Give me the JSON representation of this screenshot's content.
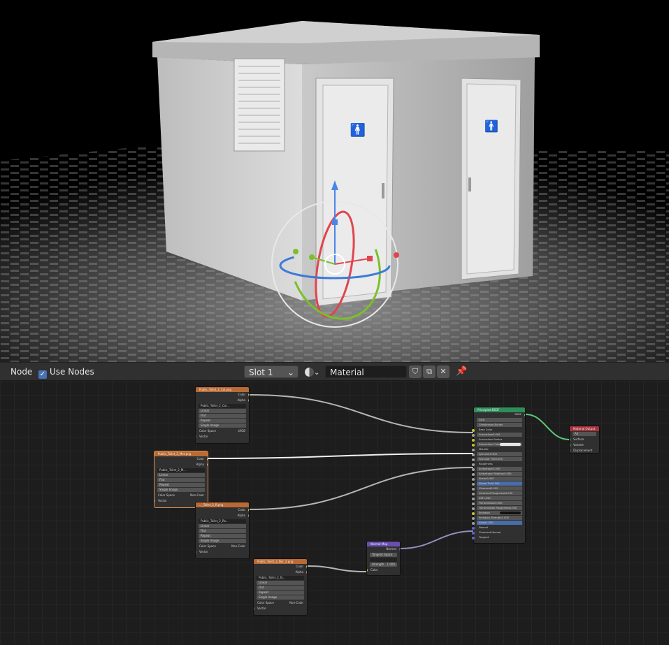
{
  "header": {
    "editor_type": "Node",
    "use_nodes_label": "Use Nodes",
    "slot": "Slot 1",
    "material_name": "Material"
  },
  "nodes": {
    "tex1": {
      "title": "Public_Toilet_2_Col.png",
      "out1": "Color",
      "out2": "Alpha",
      "image": "Public_Toilet_2_Col...",
      "interp": "Linear",
      "proj": "Flat",
      "ext": "Repeat",
      "source": "Single Image",
      "cs_label": "Color Space",
      "cs_value": "sRGB",
      "vector": "Vector"
    },
    "tex2": {
      "title": "Public_Toilet_2_Met.png",
      "out1": "Color",
      "out2": "Alpha",
      "image": "Public_Toilet_2_M...",
      "interp": "Linear",
      "proj": "Flat",
      "ext": "Repeat",
      "source": "Single Image",
      "cs_label": "Color Space",
      "cs_value": "Non-Color",
      "vector": "Vector"
    },
    "tex3": {
      "title": "..._Toilet_2_R.png",
      "out1": "Color",
      "out2": "Alpha",
      "image": "Public_Toilet_2_Ro...",
      "interp": "Linear",
      "proj": "Flat",
      "ext": "Repeat",
      "source": "Single Image",
      "cs_label": "Color Space",
      "cs_value": "Non-Color",
      "vector": "Vector"
    },
    "tex4": {
      "title": "Public_Toilet_2_Nor_2.png",
      "out1": "Color",
      "out2": "Alpha",
      "image": "Public_Toilet_2_N...",
      "interp": "Linear",
      "proj": "Flat",
      "ext": "Repeat",
      "source": "Single Image",
      "cs_label": "Color Space",
      "cs_value": "Non-Color",
      "vector": "Vector"
    },
    "normalmap": {
      "title": "Normal Map",
      "out": "Normal",
      "space": "Tangent Space",
      "strength_label": "Strength",
      "strength_value": "1.000",
      "color": "Color"
    },
    "bsdf": {
      "title": "Principled BSDF",
      "out": "BSDF",
      "dist": "GGX",
      "sss": "Christensen-Burley",
      "rows": [
        {
          "label": "Base Color",
          "value": ""
        },
        {
          "label": "Subsurface",
          "value": "0.000"
        },
        {
          "label": "Subsurface Radius",
          "value": ""
        },
        {
          "label": "Subsurface Color",
          "value": ""
        },
        {
          "label": "Metallic",
          "value": ""
        },
        {
          "label": "Specular",
          "value": "0.500"
        },
        {
          "label": "Specular Tint",
          "value": "0.000"
        },
        {
          "label": "Roughness",
          "value": ""
        },
        {
          "label": "Anisotropic",
          "value": "0.000"
        },
        {
          "label": "Anisotropic Rotation",
          "value": "0.000"
        },
        {
          "label": "Sheen",
          "value": "0.000"
        },
        {
          "label": "Sheen Tint",
          "value": "0.500"
        },
        {
          "label": "Clearcoat",
          "value": "0.000"
        },
        {
          "label": "Clearcoat Roughness",
          "value": "0.030"
        },
        {
          "label": "IOR",
          "value": "1.450"
        },
        {
          "label": "Transmission",
          "value": "0.000"
        },
        {
          "label": "Transmission Roughness",
          "value": "0.000"
        },
        {
          "label": "Emission",
          "value": ""
        },
        {
          "label": "Emission Strength",
          "value": "1.000"
        },
        {
          "label": "Alpha",
          "value": "1.000"
        },
        {
          "label": "Normal",
          "value": ""
        },
        {
          "label": "Clearcoat Normal",
          "value": ""
        },
        {
          "label": "Tangent",
          "value": ""
        }
      ]
    },
    "output": {
      "title": "Material Output",
      "target": "All",
      "in1": "Surface",
      "in2": "Volume",
      "in3": "Displacement"
    }
  }
}
